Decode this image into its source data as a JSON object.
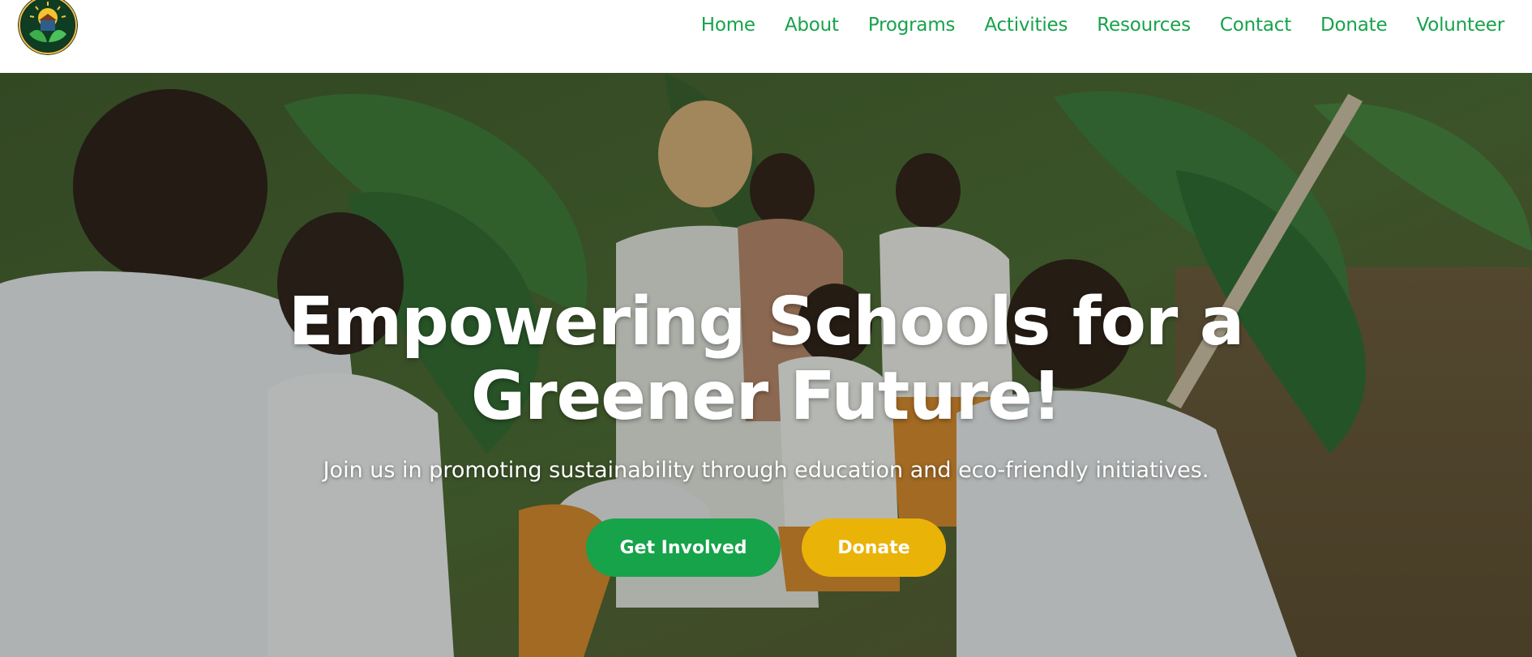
{
  "header": {
    "logo_icon": "school-sustainability-logo-icon",
    "nav": [
      {
        "label": "Home"
      },
      {
        "label": "About"
      },
      {
        "label": "Programs"
      },
      {
        "label": "Activities"
      },
      {
        "label": "Resources"
      },
      {
        "label": "Contact"
      },
      {
        "label": "Donate"
      },
      {
        "label": "Volunteer"
      }
    ]
  },
  "hero": {
    "background_image": "students-and-volunteer-in-banana-garden-photo",
    "title_line1": "Empowering Schools for a",
    "title_line2": "Greener Future!",
    "subtitle": "Join us in promoting sustainability through education and eco-friendly initiatives.",
    "primary_cta": "Get Involved",
    "secondary_cta": "Donate"
  },
  "colors": {
    "brand_green": "#16a34a",
    "accent_gold": "#eab308",
    "hero_text": "#ffffff"
  }
}
